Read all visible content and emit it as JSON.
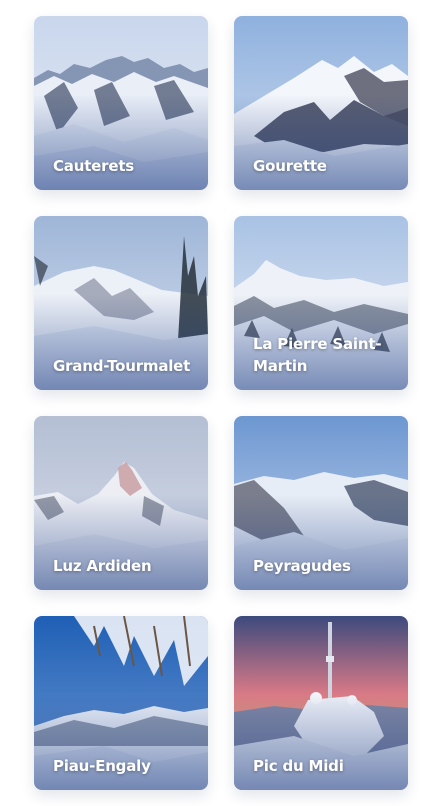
{
  "resorts": [
    {
      "name": "Cauterets",
      "image": "snowy-mountain-range-photo"
    },
    {
      "name": "Gourette",
      "image": "snowy-ridge-photo"
    },
    {
      "name": "Grand-Tourmalet",
      "image": "mountain-with-trees-photo"
    },
    {
      "name": "La Pierre Saint-Martin",
      "image": "snowy-forest-peak-photo"
    },
    {
      "name": "Luz Ardiden",
      "image": "alpenglow-peak-photo"
    },
    {
      "name": "Peyragudes",
      "image": "valley-mountains-photo"
    },
    {
      "name": "Piau-Engaly",
      "image": "frosted-branches-photo"
    },
    {
      "name": "Pic du Midi",
      "image": "observatory-sunset-photo"
    }
  ]
}
